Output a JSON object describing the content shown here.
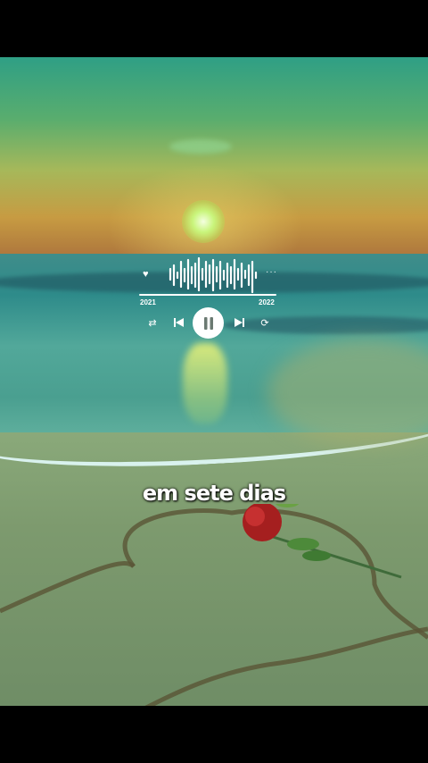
{
  "player": {
    "time_start": "2021",
    "time_end": "2022",
    "progress": 1.0,
    "icons": [
      "heart-icon",
      "more-icon",
      "shuffle-icon",
      "previous-icon",
      "pause-icon",
      "next-icon",
      "repeat-icon"
    ]
  },
  "lyric": {
    "text": "em sete dias"
  },
  "colors": {
    "controls": "#ffffff",
    "background": "#000000"
  }
}
